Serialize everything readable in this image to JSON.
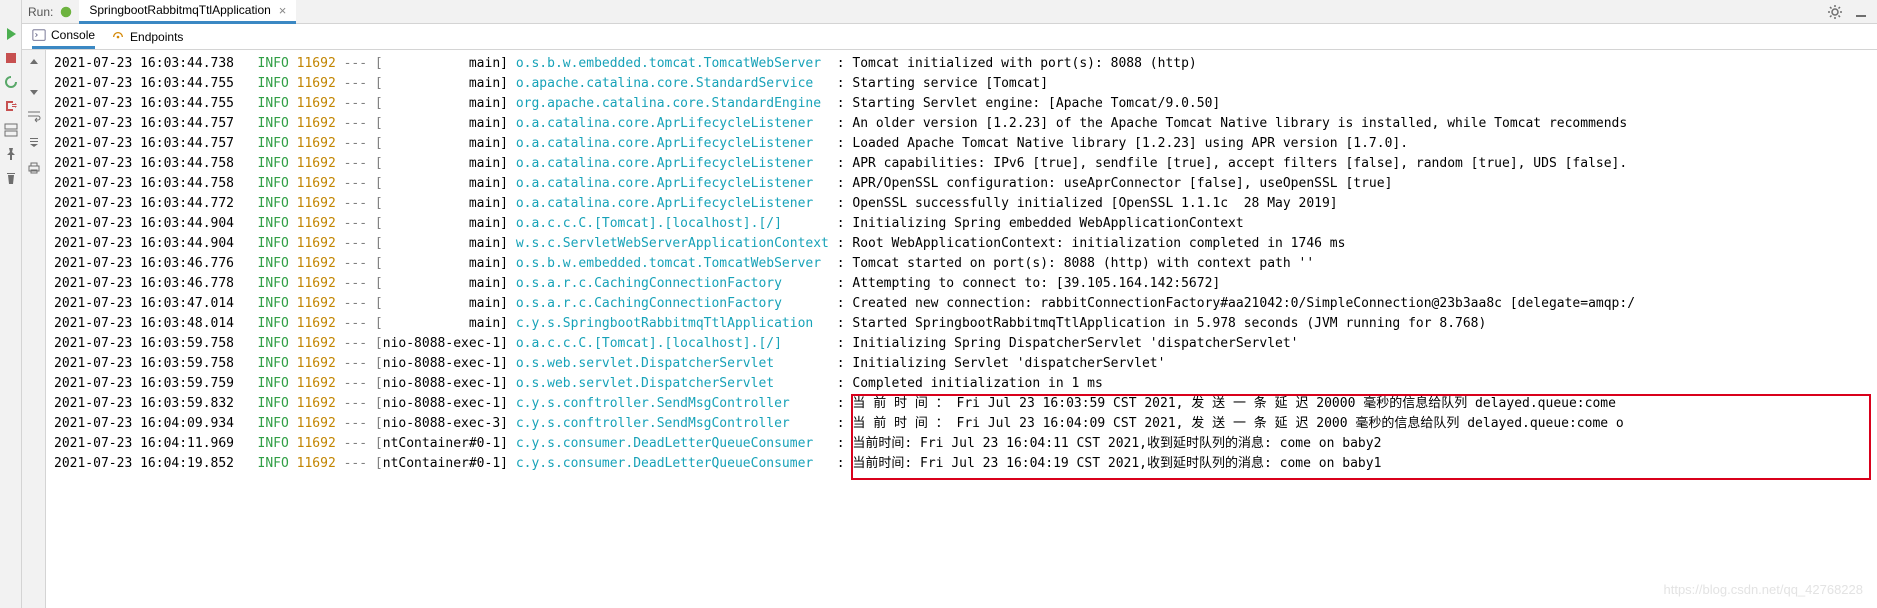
{
  "header": {
    "run_label": "Run:",
    "tab_title": "SpringbootRabbitmqTtlApplication"
  },
  "panel_tabs": {
    "console": "Console",
    "endpoints": "Endpoints"
  },
  "watermark": "https://blog.csdn.net/qq_42768228",
  "padding": {
    "thread_main": "           main] ",
    "thread_exec1": "nio-8088-exec-1] ",
    "thread_exec3": "nio-8088-exec-3] ",
    "thread_nt01": "ntContainer#0-1] "
  },
  "log_lines": [
    {
      "ts": "2021-07-23 16:03:44.738",
      "level": "INFO",
      "pid": "11692",
      "dashes": "--- [",
      "thread": "thread_main",
      "logger": "o.s.b.w.embedded.tomcat.TomcatWebServer  ",
      "msg": "Tomcat initialized with port(s): 8088 (http)"
    },
    {
      "ts": "2021-07-23 16:03:44.755",
      "level": "INFO",
      "pid": "11692",
      "dashes": "--- [",
      "thread": "thread_main",
      "logger": "o.apache.catalina.core.StandardService   ",
      "msg": "Starting service [Tomcat]"
    },
    {
      "ts": "2021-07-23 16:03:44.755",
      "level": "INFO",
      "pid": "11692",
      "dashes": "--- [",
      "thread": "thread_main",
      "logger": "org.apache.catalina.core.StandardEngine  ",
      "msg": "Starting Servlet engine: [Apache Tomcat/9.0.50]"
    },
    {
      "ts": "2021-07-23 16:03:44.757",
      "level": "INFO",
      "pid": "11692",
      "dashes": "--- [",
      "thread": "thread_main",
      "logger": "o.a.catalina.core.AprLifecycleListener   ",
      "msg": "An older version [1.2.23] of the Apache Tomcat Native library is installed, while Tomcat recommends"
    },
    {
      "ts": "2021-07-23 16:03:44.757",
      "level": "INFO",
      "pid": "11692",
      "dashes": "--- [",
      "thread": "thread_main",
      "logger": "o.a.catalina.core.AprLifecycleListener   ",
      "msg": "Loaded Apache Tomcat Native library [1.2.23] using APR version [1.7.0]."
    },
    {
      "ts": "2021-07-23 16:03:44.758",
      "level": "INFO",
      "pid": "11692",
      "dashes": "--- [",
      "thread": "thread_main",
      "logger": "o.a.catalina.core.AprLifecycleListener   ",
      "msg": "APR capabilities: IPv6 [true], sendfile [true], accept filters [false], random [true], UDS [false]."
    },
    {
      "ts": "2021-07-23 16:03:44.758",
      "level": "INFO",
      "pid": "11692",
      "dashes": "--- [",
      "thread": "thread_main",
      "logger": "o.a.catalina.core.AprLifecycleListener   ",
      "msg": "APR/OpenSSL configuration: useAprConnector [false], useOpenSSL [true]"
    },
    {
      "ts": "2021-07-23 16:03:44.772",
      "level": "INFO",
      "pid": "11692",
      "dashes": "--- [",
      "thread": "thread_main",
      "logger": "o.a.catalina.core.AprLifecycleListener   ",
      "msg": "OpenSSL successfully initialized [OpenSSL 1.1.1c  28 May 2019]"
    },
    {
      "ts": "2021-07-23 16:03:44.904",
      "level": "INFO",
      "pid": "11692",
      "dashes": "--- [",
      "thread": "thread_main",
      "logger": "o.a.c.c.C.[Tomcat].[localhost].[/]       ",
      "msg": "Initializing Spring embedded WebApplicationContext"
    },
    {
      "ts": "2021-07-23 16:03:44.904",
      "level": "INFO",
      "pid": "11692",
      "dashes": "--- [",
      "thread": "thread_main",
      "logger": "w.s.c.ServletWebServerApplicationContext ",
      "msg": "Root WebApplicationContext: initialization completed in 1746 ms"
    },
    {
      "ts": "2021-07-23 16:03:46.776",
      "level": "INFO",
      "pid": "11692",
      "dashes": "--- [",
      "thread": "thread_main",
      "logger": "o.s.b.w.embedded.tomcat.TomcatWebServer  ",
      "msg": "Tomcat started on port(s): 8088 (http) with context path ''"
    },
    {
      "ts": "2021-07-23 16:03:46.778",
      "level": "INFO",
      "pid": "11692",
      "dashes": "--- [",
      "thread": "thread_main",
      "logger": "o.s.a.r.c.CachingConnectionFactory       ",
      "msg": "Attempting to connect to: [39.105.164.142:5672]"
    },
    {
      "ts": "2021-07-23 16:03:47.014",
      "level": "INFO",
      "pid": "11692",
      "dashes": "--- [",
      "thread": "thread_main",
      "logger": "o.s.a.r.c.CachingConnectionFactory       ",
      "msg": "Created new connection: rabbitConnectionFactory#aa21042:0/SimpleConnection@23b3aa8c [delegate=amqp:/"
    },
    {
      "ts": "2021-07-23 16:03:48.014",
      "level": "INFO",
      "pid": "11692",
      "dashes": "--- [",
      "thread": "thread_main",
      "logger": "c.y.s.SpringbootRabbitmqTtlApplication   ",
      "msg": "Started SpringbootRabbitmqTtlApplication in 5.978 seconds (JVM running for 8.768)"
    },
    {
      "ts": "2021-07-23 16:03:59.758",
      "level": "INFO",
      "pid": "11692",
      "dashes": "--- [",
      "thread": "thread_exec1",
      "logger": "o.a.c.c.C.[Tomcat].[localhost].[/]       ",
      "msg": "Initializing Spring DispatcherServlet 'dispatcherServlet'"
    },
    {
      "ts": "2021-07-23 16:03:59.758",
      "level": "INFO",
      "pid": "11692",
      "dashes": "--- [",
      "thread": "thread_exec1",
      "logger": "o.s.web.servlet.DispatcherServlet        ",
      "msg": "Initializing Servlet 'dispatcherServlet'"
    },
    {
      "ts": "2021-07-23 16:03:59.759",
      "level": "INFO",
      "pid": "11692",
      "dashes": "--- [",
      "thread": "thread_exec1",
      "logger": "o.s.web.servlet.DispatcherServlet        ",
      "msg": "Completed initialization in 1 ms"
    },
    {
      "ts": "2021-07-23 16:03:59.832",
      "level": "INFO",
      "pid": "11692",
      "dashes": "--- [",
      "thread": "thread_exec1",
      "logger": "c.y.s.conftroller.SendMsgController      ",
      "msg": "当 前 时 间 ： Fri Jul 23 16:03:59 CST 2021, 发 送 一 条 延 迟 20000 毫秒的信息给队列 delayed.queue:come"
    },
    {
      "ts": "2021-07-23 16:04:09.934",
      "level": "INFO",
      "pid": "11692",
      "dashes": "--- [",
      "thread": "thread_exec3",
      "logger": "c.y.s.conftroller.SendMsgController      ",
      "msg": "当 前 时 间 ： Fri Jul 23 16:04:09 CST 2021, 发 送 一 条 延 迟 2000 毫秒的信息给队列 delayed.queue:come o"
    },
    {
      "ts": "2021-07-23 16:04:11.969",
      "level": "INFO",
      "pid": "11692",
      "dashes": "--- [",
      "thread": "thread_nt01",
      "logger": "c.y.s.consumer.DeadLetterQueueConsumer   ",
      "msg": "当前时间: Fri Jul 23 16:04:11 CST 2021,收到延时队列的消息: come on baby2"
    },
    {
      "ts": "2021-07-23 16:04:19.852",
      "level": "INFO",
      "pid": "11692",
      "dashes": "--- [",
      "thread": "thread_nt01",
      "logger": "c.y.s.consumer.DeadLetterQueueConsumer   ",
      "msg": "当前时间: Fri Jul 23 16:04:19 CST 2021,收到延时队列的消息: come on baby1"
    }
  ]
}
